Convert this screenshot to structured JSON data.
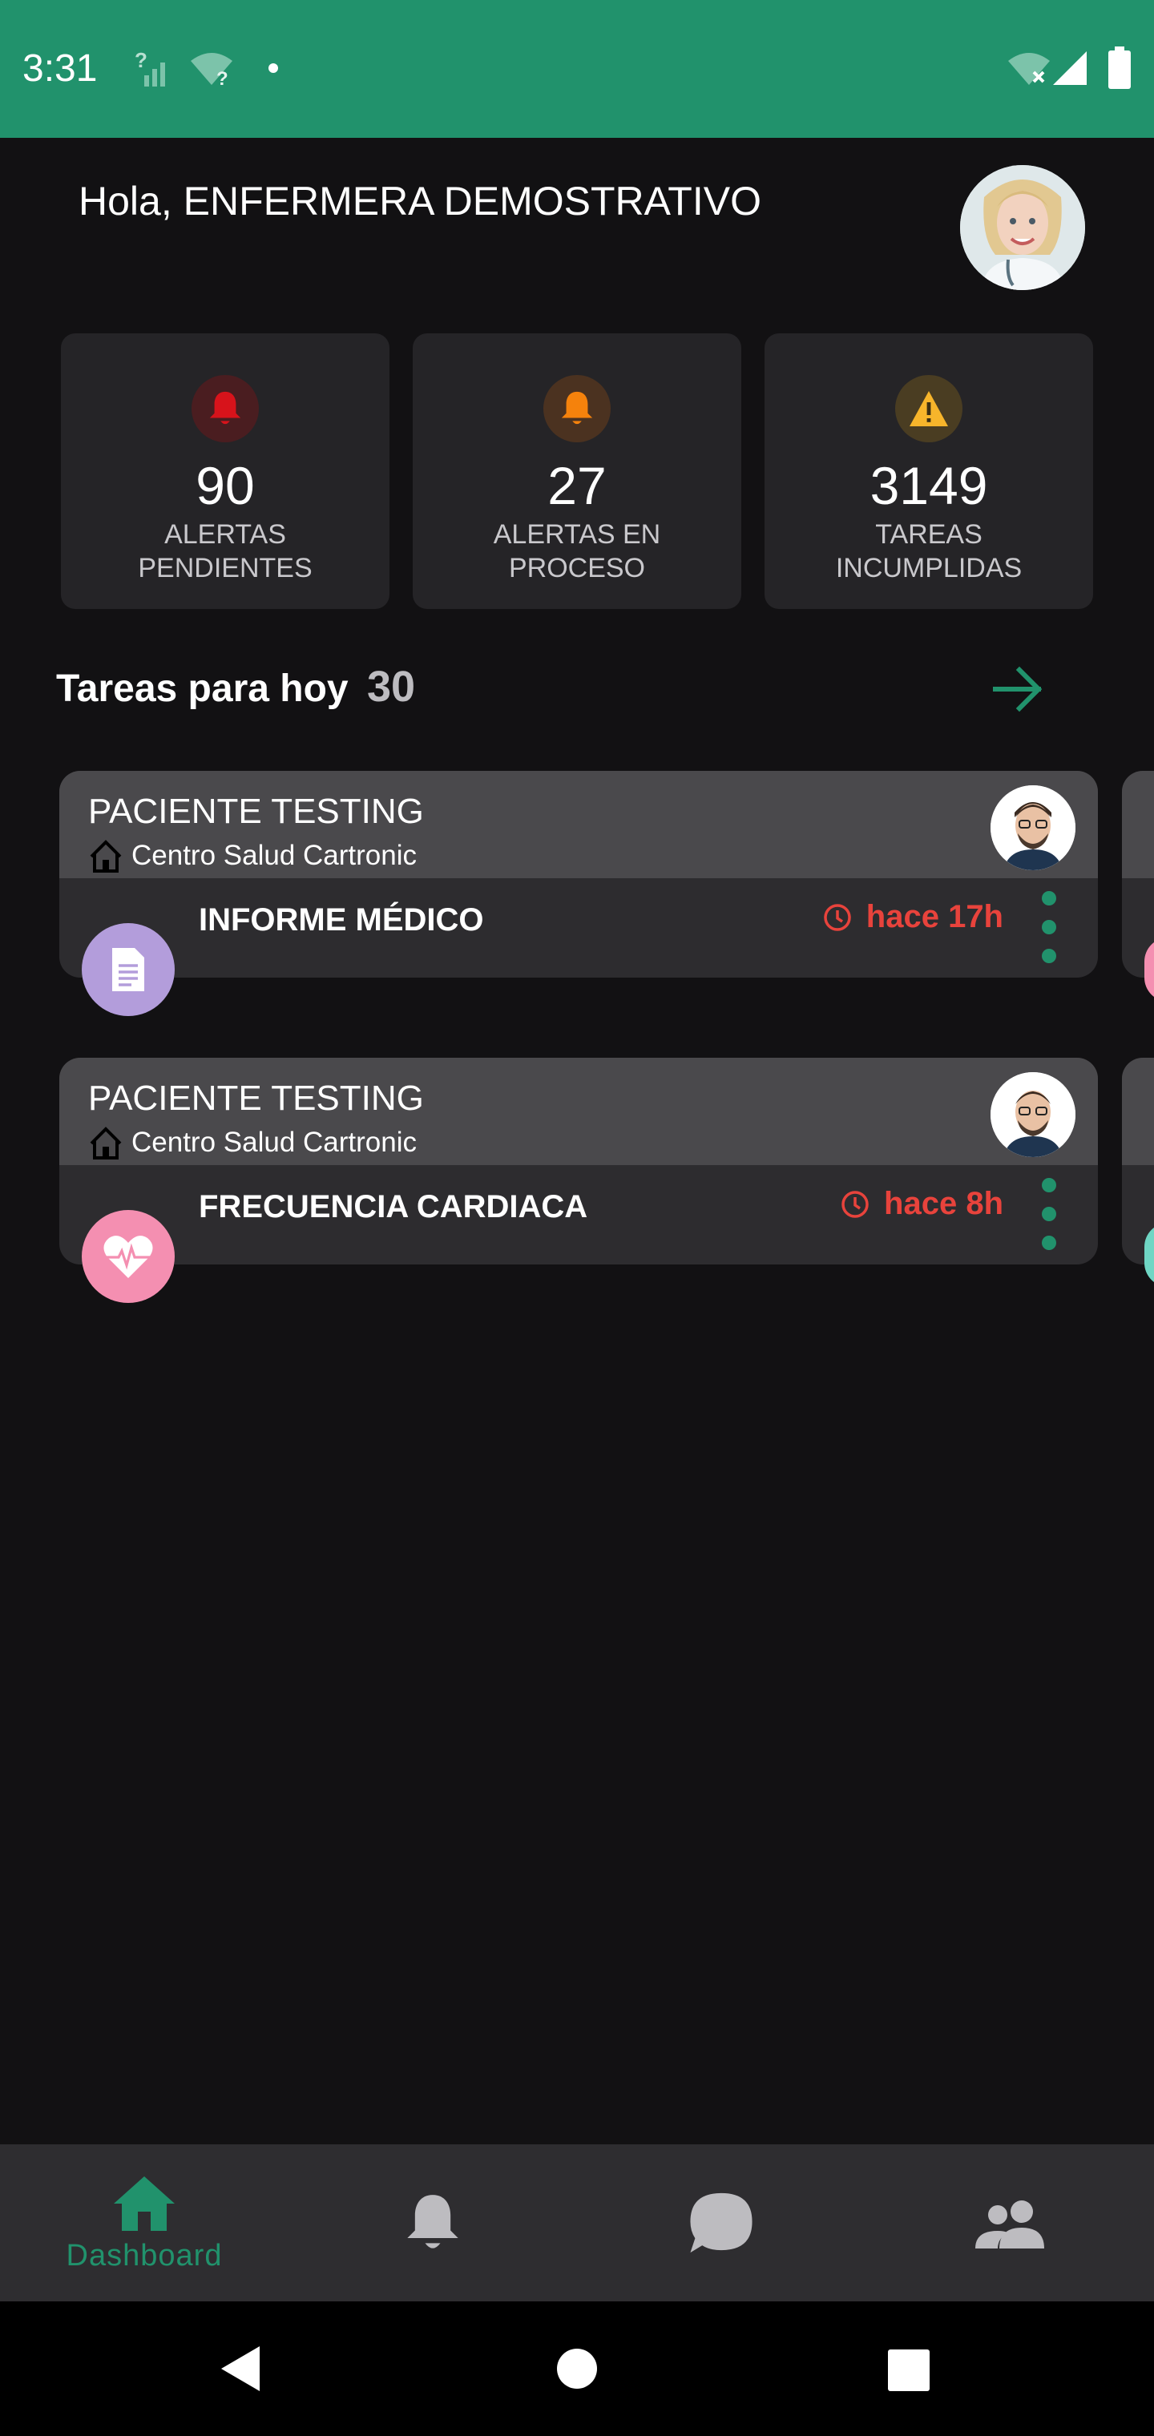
{
  "status_bar": {
    "time": "3:31",
    "icons": [
      "signal-unknown-icon",
      "wifi-unknown-icon",
      "dot-icon",
      "wifi-off-icon",
      "cell-signal-icon",
      "battery-icon"
    ],
    "color": "#21926c"
  },
  "header": {
    "greeting": "Hola, ENFERMERA DEMOSTRATIVO",
    "avatar": "nurse-avatar"
  },
  "stats": [
    {
      "value": "90",
      "label_line1": "ALERTAS",
      "label_line2": "PENDIENTES",
      "icon": "bell-icon",
      "color": "#d7131b"
    },
    {
      "value": "27",
      "label_line1": "ALERTAS EN",
      "label_line2": "PROCESO",
      "icon": "bell-icon",
      "color": "#f5820c"
    },
    {
      "value": "3149",
      "label_line1": "TAREAS",
      "label_line2": "INCUMPLIDAS",
      "icon": "warning-icon",
      "color": "#f7b52b"
    }
  ],
  "tasks": {
    "title": "Tareas para hoy",
    "count": "30",
    "items": [
      {
        "patient": "PACIENTE TESTING",
        "center": "Centro Salud Cartronic",
        "task": "INFORME MÉDICO",
        "time": "hace 17h",
        "type_icon": "document-icon",
        "type_color": "#b39ddb"
      },
      {
        "patient": "PACIENTE TESTING",
        "center": "Centro Salud Cartronic",
        "task": "FRECUENCIA CARDIACA",
        "time": "hace 8h",
        "type_icon": "heart-rate-icon",
        "type_color": "#f48fb1"
      }
    ]
  },
  "bottom_nav": {
    "items": [
      {
        "label": "Dashboard",
        "icon": "home-icon",
        "active": true
      },
      {
        "label": "",
        "icon": "bell-icon",
        "active": false
      },
      {
        "label": "",
        "icon": "chat-icon",
        "active": false
      },
      {
        "label": "",
        "icon": "people-icon",
        "active": false
      }
    ],
    "accent": "#21926c"
  },
  "system_nav": [
    "back-icon",
    "home-circle-icon",
    "recents-icon"
  ]
}
